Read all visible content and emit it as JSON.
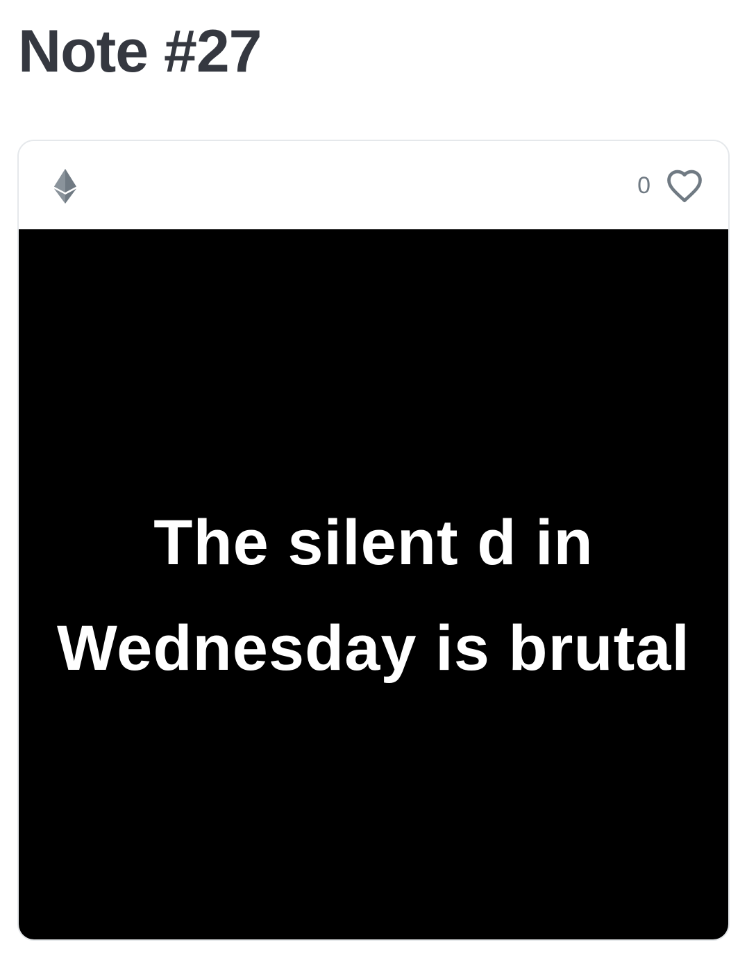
{
  "page": {
    "title": "Note #27"
  },
  "card": {
    "chain_icon": "ethereum-icon",
    "favorite_count": "0",
    "favorite_icon": "heart-outline-icon",
    "media_text": "The silent d in\nWednesday is brutal"
  },
  "colors": {
    "title": "#353840",
    "muted_icon": "#707a83",
    "card_border": "#e5e8eb",
    "media_background": "#000000",
    "media_text": "#ffffff"
  }
}
